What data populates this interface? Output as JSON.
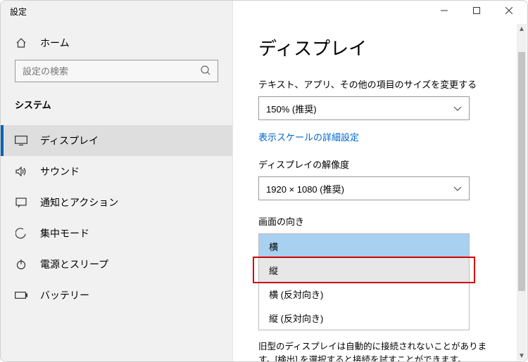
{
  "window": {
    "title": "設定"
  },
  "sidebar": {
    "home": "ホーム",
    "search_placeholder": "設定の検索",
    "category": "システム",
    "items": [
      {
        "label": "ディスプレイ",
        "icon": "display",
        "selected": true
      },
      {
        "label": "サウンド",
        "icon": "sound"
      },
      {
        "label": "通知とアクション",
        "icon": "notifications"
      },
      {
        "label": "集中モード",
        "icon": "focus"
      },
      {
        "label": "電源とスリープ",
        "icon": "power"
      },
      {
        "label": "バッテリー",
        "icon": "battery"
      }
    ]
  },
  "main": {
    "heading": "ディスプレイ",
    "scale_label": "テキスト、アプリ、その他の項目のサイズを変更する",
    "scale_value": "150% (推奨)",
    "advanced_scale_link": "表示スケールの詳細設定",
    "resolution_label": "ディスプレイの解像度",
    "resolution_value": "1920 × 1080 (推奨)",
    "orientation_label": "画面の向き",
    "orientation_options": [
      "横",
      "縦",
      "横 (反対向き)",
      "縦 (反対向き)"
    ],
    "footnote": "旧型のディスプレイは自動的に接続されないことがあります。[検出] を選択すると接続を試すことができます。"
  }
}
